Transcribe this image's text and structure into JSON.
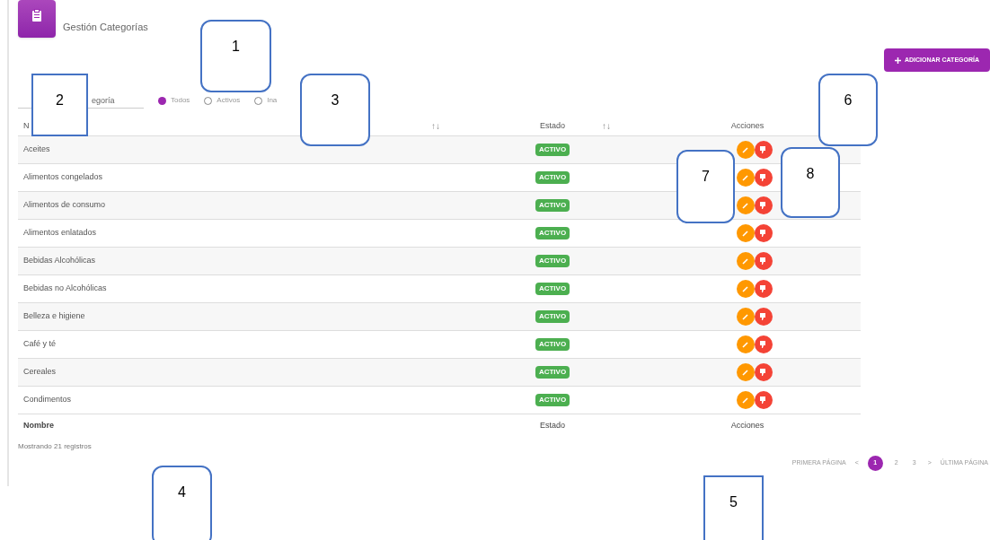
{
  "header": {
    "title": "Gestión Categorías"
  },
  "add_button": {
    "label": "ADICIONAR CATEGORÍA"
  },
  "search": {
    "placeholder": "egoría"
  },
  "filters": [
    {
      "label": "Todos",
      "selected": true
    },
    {
      "label": "Activos",
      "selected": false
    },
    {
      "label": "Ina",
      "selected": false
    }
  ],
  "table": {
    "columns": [
      {
        "label": "N",
        "sort": "↑↓"
      },
      {
        "label": "Estado",
        "sort": "↑↓"
      },
      {
        "label": "Acciones"
      }
    ],
    "rows": [
      {
        "name": "Aceites",
        "status": "ACTIVO"
      },
      {
        "name": "Alimentos congelados",
        "status": "ACTIVO"
      },
      {
        "name": "Alimentos de consumo",
        "status": "ACTIVO"
      },
      {
        "name": "Alimentos enlatados",
        "status": "ACTIVO"
      },
      {
        "name": "Bebidas Alcohólicas",
        "status": "ACTIVO"
      },
      {
        "name": "Bebidas no Alcohólicas",
        "status": "ACTIVO"
      },
      {
        "name": "Belleza e higiene",
        "status": "ACTIVO"
      },
      {
        "name": "Café y té",
        "status": "ACTIVO"
      },
      {
        "name": "Cereales",
        "status": "ACTIVO"
      },
      {
        "name": "Condimentos",
        "status": "ACTIVO"
      }
    ],
    "footer": [
      "Nombre",
      "Estado",
      "Acciones"
    ]
  },
  "record_count": "Mostrando 21 registros",
  "pagination": {
    "first": "PRIMERA PÁGINA",
    "prev": "<",
    "pages": [
      {
        "label": "1",
        "selected": true
      },
      {
        "label": "2",
        "selected": false
      },
      {
        "label": "3",
        "selected": false
      }
    ],
    "next": ">",
    "last": "ÚLTIMA PÁGINA"
  },
  "callouts": [
    {
      "number": "1"
    },
    {
      "number": "2"
    },
    {
      "number": "3"
    },
    {
      "number": "4"
    },
    {
      "number": "5"
    },
    {
      "number": "6"
    },
    {
      "number": "7"
    },
    {
      "number": "8"
    }
  ]
}
